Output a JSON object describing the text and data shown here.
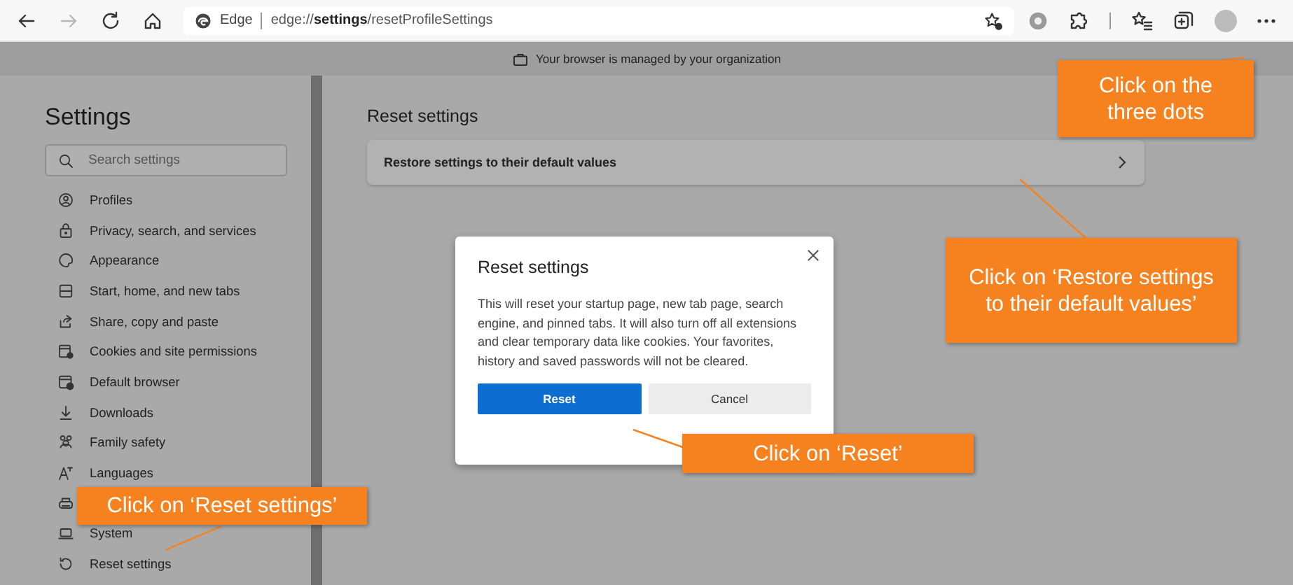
{
  "toolbar": {
    "forward_disabled": true,
    "site_label": "Edge",
    "url": "edge://**settings**/resetProfileSettings"
  },
  "managed_banner": "Your browser is managed by your organization",
  "sidebar": {
    "title": "Settings",
    "search": {
      "placeholder": "Search settings"
    },
    "items": [
      {
        "kind": "entry",
        "label": "Profiles"
      },
      {
        "kind": "entry",
        "label": "Privacy, search, and services"
      },
      {
        "kind": "entry",
        "label": "Appearance"
      },
      {
        "kind": "entry",
        "label": "Start, home, and new tabs"
      },
      {
        "kind": "entry",
        "label": "Share, copy and paste"
      },
      {
        "kind": "entry",
        "label": "Cookies and site permissions"
      },
      {
        "kind": "entry",
        "label": "Default browser"
      },
      {
        "kind": "entry",
        "label": "Downloads"
      },
      {
        "kind": "entry",
        "label": "Family safety"
      },
      {
        "kind": "entry",
        "label": "Languages"
      },
      {
        "kind": "covered"
      },
      {
        "kind": "entry",
        "label": "System"
      },
      {
        "kind": "entry",
        "label": "Reset settings"
      }
    ]
  },
  "main": {
    "heading": "Reset settings",
    "rows": [
      {
        "label": "Restore settings to their default values"
      }
    ]
  },
  "dialog": {
    "title": "Reset settings",
    "body": "This will reset your startup page, new tab page, search engine, and pinned tabs. It will also turn off all extensions and clear temporary data like cookies. Your favorites, history and saved passwords will not be cleared.",
    "buttons": [
      {
        "kind": "primary",
        "label": "Reset"
      },
      {
        "kind": "secondary",
        "label": "Cancel"
      }
    ]
  },
  "callouts": [
    {
      "text": "Click on the three dots"
    },
    {
      "text": "Click on ‘Restore settings to their default values’"
    },
    {
      "text": "Click on ‘Reset’"
    },
    {
      "text": "Click on ‘Reset settings’"
    }
  ]
}
